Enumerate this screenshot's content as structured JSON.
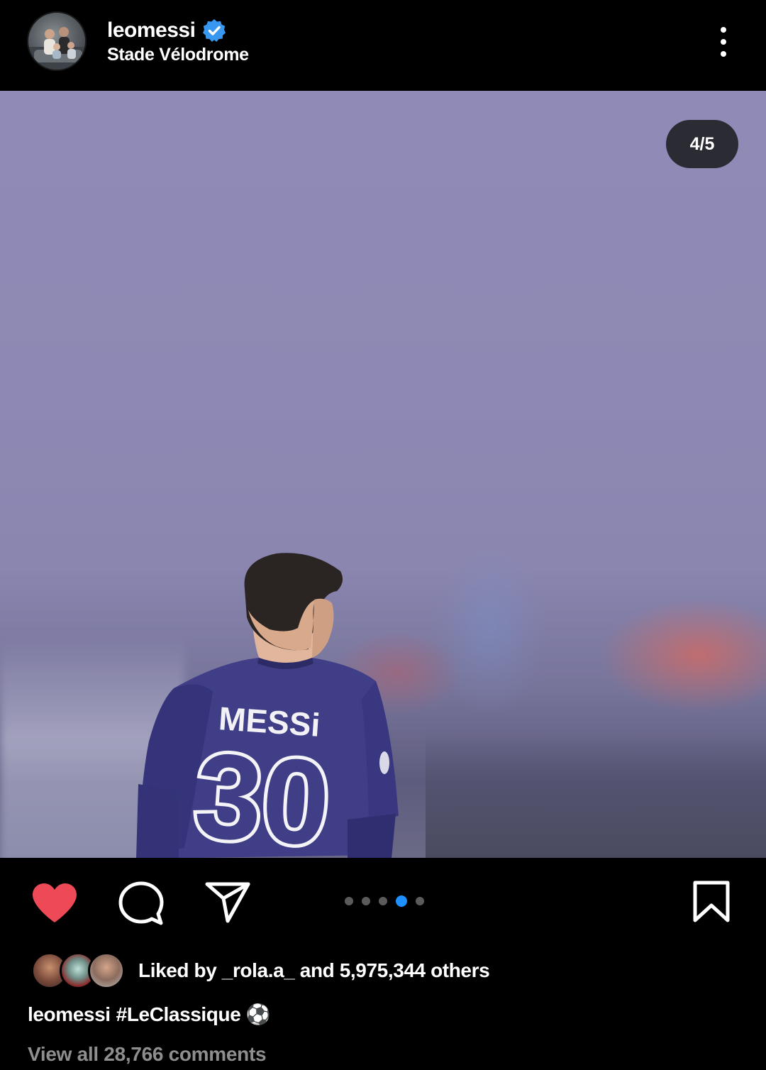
{
  "header": {
    "username": "leomessi",
    "verified": true,
    "location": "Stade Vélodrome",
    "avatar_icon": "profile-photo"
  },
  "post": {
    "carousel_counter": "4/5",
    "carousel_total": 5,
    "carousel_current": 4,
    "jersey_name": "MESSi",
    "jersey_number": "30"
  },
  "actions": {
    "like_icon": "heart-filled-icon",
    "comment_icon": "comment-icon",
    "share_icon": "send-icon",
    "save_icon": "bookmark-icon",
    "liked": true
  },
  "likes": {
    "text": "Liked by _rola.a_ and 5,975,344 others"
  },
  "caption": {
    "username": "leomessi",
    "text": "#LeClassique ⚽"
  },
  "comments": {
    "link_text": "View all 28,766 comments"
  },
  "colors": {
    "background": "#000000",
    "like_red": "#ed4956",
    "verified_blue": "#3897f0",
    "active_dot": "#1e90ff",
    "muted_text": "#8e8e8e"
  }
}
